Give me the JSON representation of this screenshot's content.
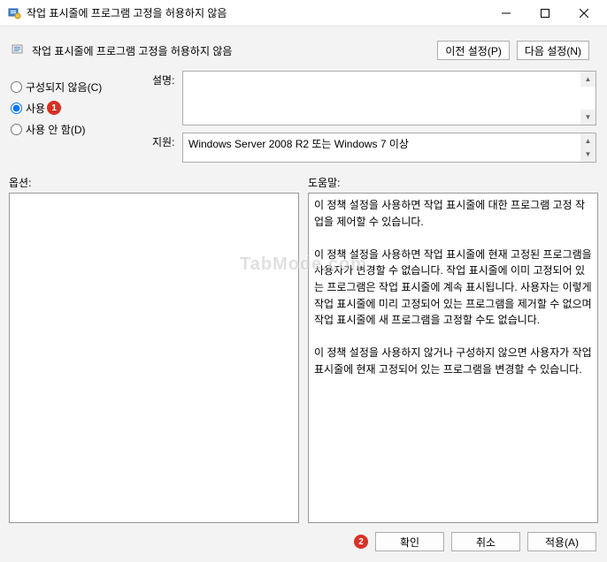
{
  "titlebar": {
    "title": "작업 표시줄에 프로그램 고정을 허용하지 않음"
  },
  "header": {
    "pagetitle": "작업 표시줄에 프로그램 고정을 허용하지 않음",
    "prev_label": "이전 설정(P)",
    "next_label": "다음 설정(N)"
  },
  "radio": {
    "not_configured": "구성되지 않음(C)",
    "enabled": "사용",
    "disabled": "사용 안 함(D)",
    "selected": "enabled"
  },
  "callouts": {
    "one": "1",
    "two": "2"
  },
  "fields": {
    "desc_label": "설명:",
    "support_label": "지원:",
    "support_value": "Windows Server 2008 R2 또는 Windows 7 이상"
  },
  "panels": {
    "options_label": "옵션:",
    "help_label": "도움말:",
    "help_text_p1": "이 정책 설정을 사용하면 작업 표시줄에 대한 프로그램 고정 작업을 제어할 수 있습니다.",
    "help_text_p2": "이 정책 설정을 사용하면 작업 표시줄에 현재 고정된 프로그램을 사용자가 변경할 수 없습니다. 작업 표시줄에 이미 고정되어 있는 프로그램은 작업 표시줄에 계속 표시됩니다. 사용자는 이렇게 작업 표시줄에 미리 고정되어 있는 프로그램을 제거할 수 없으며 작업 표시줄에 새 프로그램을 고정할 수도 없습니다.",
    "help_text_p3": "이 정책 설정을 사용하지 않거나 구성하지 않으면 사용자가 작업 표시줄에 현재 고정되어 있는 프로그램을 변경할 수 있습니다."
  },
  "footer": {
    "ok": "확인",
    "cancel": "취소",
    "apply": "적용(A)"
  },
  "watermark": "TabMode.com"
}
